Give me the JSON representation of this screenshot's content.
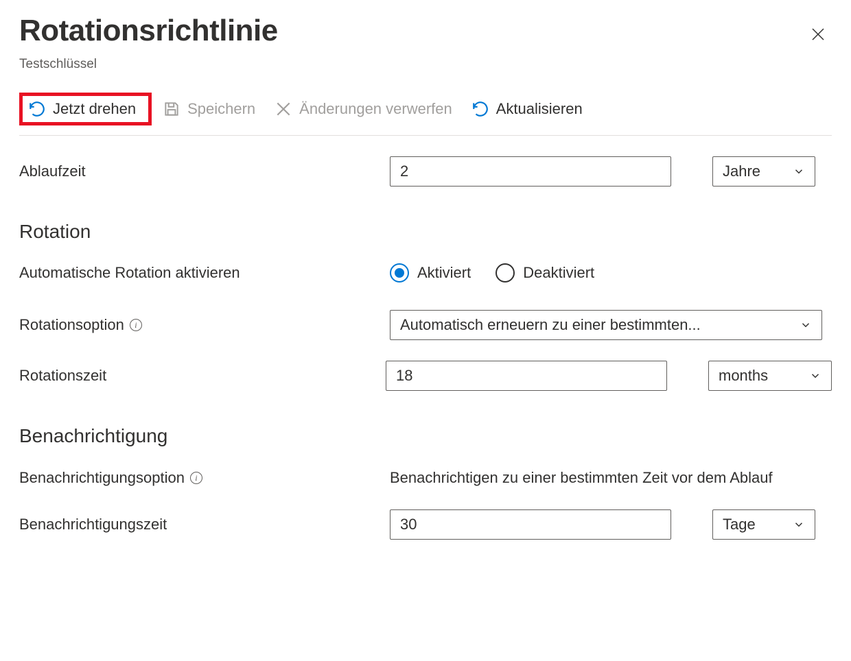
{
  "header": {
    "title": "Rotationsrichtlinie",
    "subtitle": "Testschlüssel"
  },
  "toolbar": {
    "rotate_now": "Jetzt drehen",
    "save": "Speichern",
    "discard": "Änderungen verwerfen",
    "refresh": "Aktualisieren"
  },
  "expiry": {
    "label": "Ablaufzeit",
    "value": "2",
    "unit": "Jahre"
  },
  "rotation": {
    "section_title": "Rotation",
    "enable_label": "Automatische Rotation aktivieren",
    "enabled_option": "Aktiviert",
    "disabled_option": "Deaktiviert",
    "option_label": "Rotationsoption",
    "option_value": "Automatisch erneuern zu einer bestimmten...",
    "time_label": "Rotationszeit",
    "time_value": "18",
    "time_unit": "months"
  },
  "notification": {
    "section_title": "Benachrichtigung",
    "option_label": "Benachrichtigungsoption",
    "option_value": "Benachrichtigen zu einer bestimmten Zeit vor dem Ablauf",
    "time_label": "Benachrichtigungszeit",
    "time_value": "30",
    "time_unit": "Tage"
  }
}
